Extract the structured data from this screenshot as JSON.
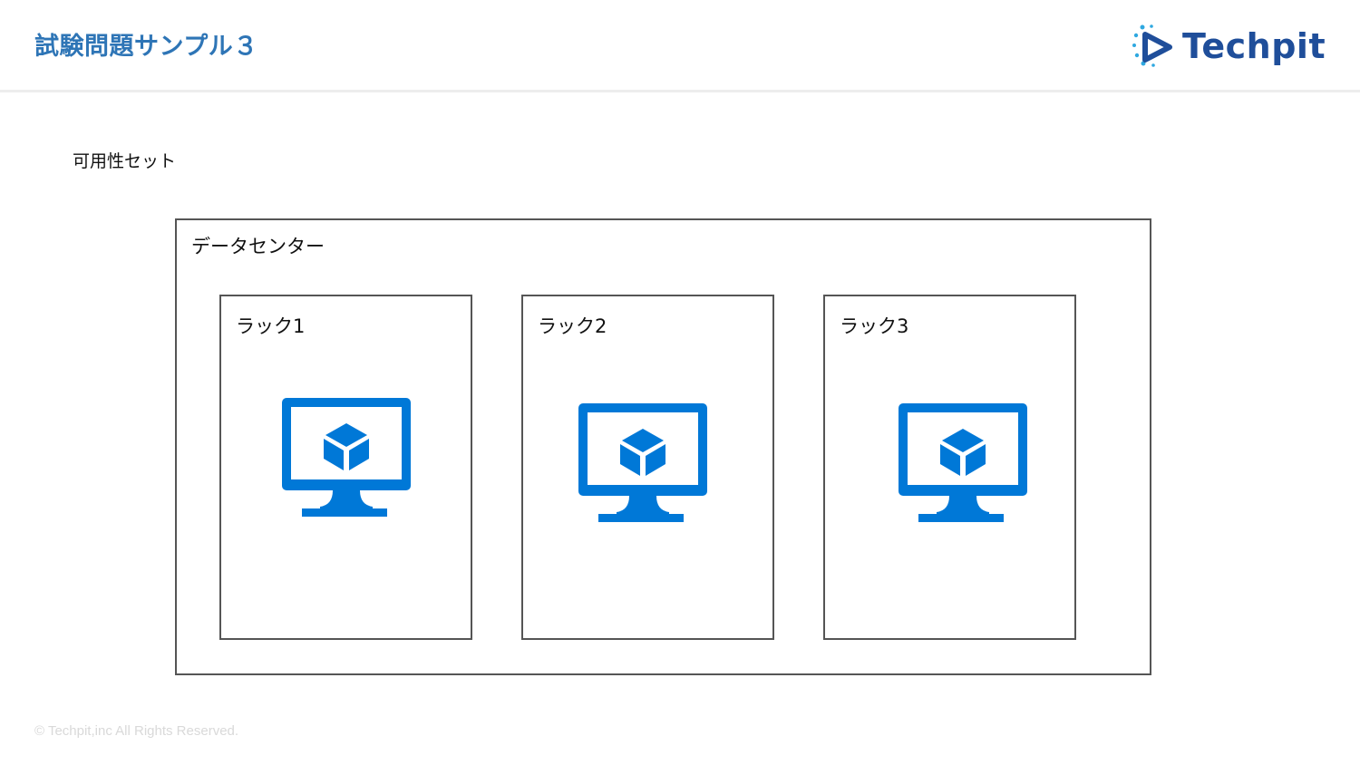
{
  "header": {
    "title": "試験問題サンプル３",
    "logo_text": "Techpit"
  },
  "subtitle": "可用性セット",
  "datacenter": {
    "label": "データセンター",
    "racks": [
      {
        "label": "ラック1",
        "icon": "virtual-machine-icon"
      },
      {
        "label": "ラック2",
        "icon": "virtual-machine-icon"
      },
      {
        "label": "ラック3",
        "icon": "virtual-machine-icon"
      }
    ]
  },
  "footer": "© Techpit,inc  All Rights Reserved.",
  "colors": {
    "title": "#2e75b6",
    "logo": "#1f4e9a",
    "vm_icon": "#0078d7",
    "border": "#555555"
  }
}
